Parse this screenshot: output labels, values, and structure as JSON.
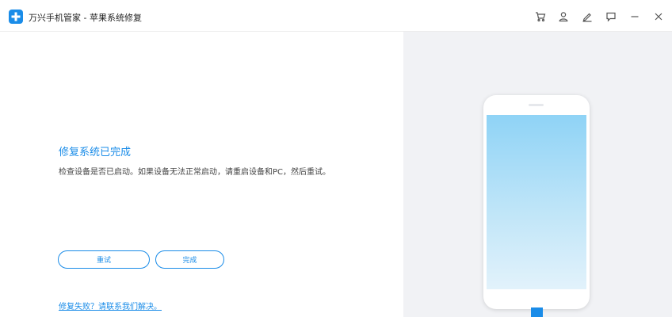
{
  "titlebar": {
    "app_title": "万兴手机管家 - 苹果系统修复",
    "icons": [
      "cart-icon",
      "user-icon",
      "edit-icon",
      "feedback-icon",
      "minimize-icon",
      "close-icon"
    ]
  },
  "status": {
    "title": "修复系统已完成",
    "description": "检查设备是否已启动。如果设备无法正常启动，请重启设备和PC，然后重试。"
  },
  "buttons": {
    "retry_label": "重试",
    "done_label": "完成"
  },
  "help_link": "修复失败？请联系我们解决。",
  "colors": {
    "accent": "#1a8ce8",
    "right_panel_bg": "#f1f2f5",
    "screen_top": "#8fd3f6",
    "screen_bottom": "#e2f2fb"
  }
}
